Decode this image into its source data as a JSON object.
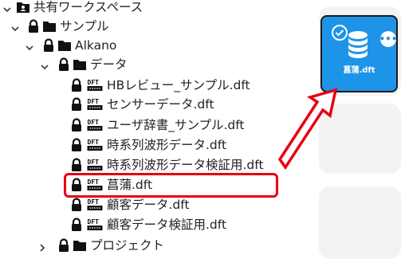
{
  "tree": {
    "items": [
      {
        "label": "共有ワークスペース",
        "type": "workspace"
      },
      {
        "label": "サンプル",
        "type": "folder"
      },
      {
        "label": "Alkano",
        "type": "folder"
      },
      {
        "label": "データ",
        "type": "folder"
      },
      {
        "label": "HBレビュー_サンプル.dft",
        "type": "file"
      },
      {
        "label": "センサーデータ.dft",
        "type": "file"
      },
      {
        "label": "ユーザ辞書_サンプル.dft",
        "type": "file"
      },
      {
        "label": "時系列波形データ.dft",
        "type": "file"
      },
      {
        "label": "時系列波形データ検証用.dft",
        "type": "file"
      },
      {
        "label": "菖蒲.dft",
        "type": "file",
        "highlighted": true
      },
      {
        "label": "顧客データ.dft",
        "type": "file"
      },
      {
        "label": "顧客データ検証用.dft",
        "type": "file"
      },
      {
        "label": "プロジェクト",
        "type": "folder"
      }
    ]
  },
  "tile": {
    "label": "菖蒲.dft",
    "color": "#1e94e8",
    "icon": "database-icon",
    "menu_icon": "more-horizontal-icon",
    "status_icon": "check-circle-icon"
  },
  "highlight_color": "#e60012"
}
